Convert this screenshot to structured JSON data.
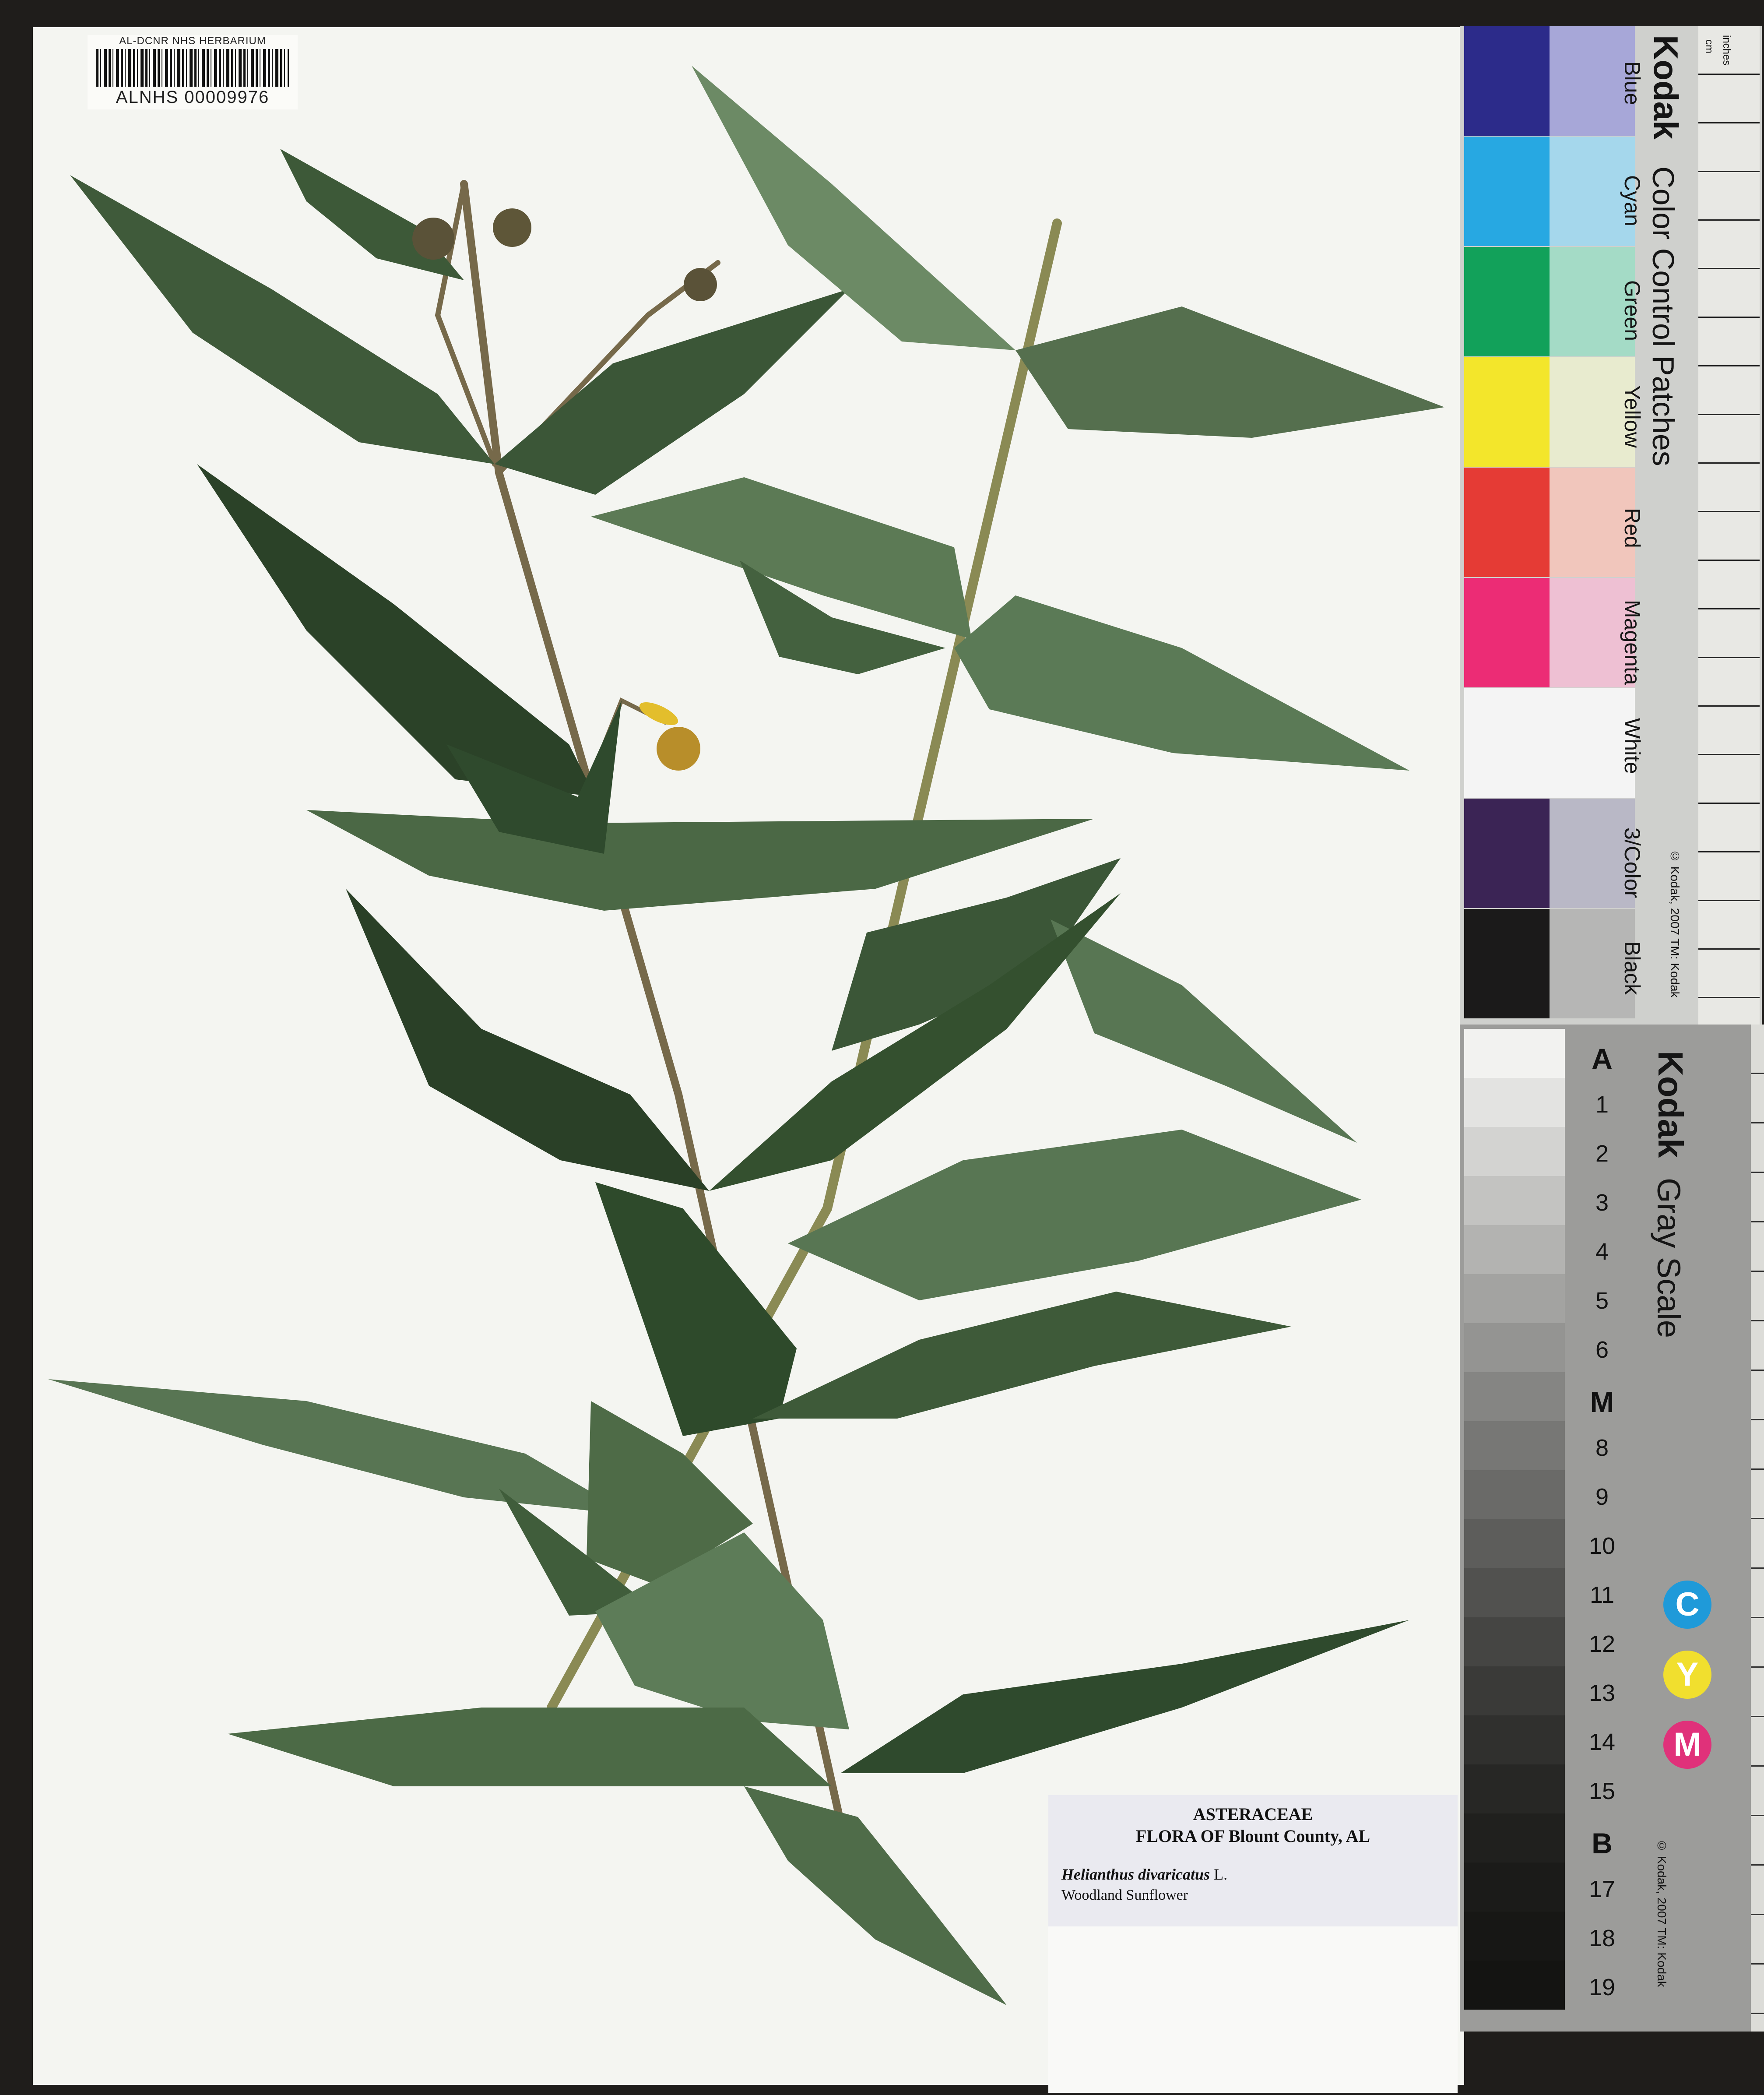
{
  "barcode": {
    "header": "AL-DCNR NHS HERBARIUM",
    "number": "ALNHS 00009976"
  },
  "color_card": {
    "brand": "Kodak",
    "title": "Color Control Patches",
    "patch_names": [
      "Blue",
      "Cyan",
      "Green",
      "Yellow",
      "Red",
      "Magenta",
      "White",
      "3/Color",
      "Black"
    ],
    "patch_colors": [
      [
        "#2c2b8a",
        "#a7a7d8"
      ],
      [
        "#27a8e2",
        "#a5d7ec"
      ],
      [
        "#12a15a",
        "#a4dbc6"
      ],
      [
        "#f3e62b",
        "#e8ebcf"
      ],
      [
        "#e53b35",
        "#f1c6bc"
      ],
      [
        "#ec2c75",
        "#eec0d3"
      ],
      [
        "#f4f4f4",
        "#f4f4f4"
      ],
      [
        "#3b2455",
        "#b9b8c6"
      ],
      [
        "#1b1a1a",
        "#b6b6b5"
      ]
    ],
    "copyright": "© Kodak, 2007 TM: Kodak",
    "ruler_units": [
      "inches",
      "cm"
    ]
  },
  "gray_card": {
    "brand": "Kodak",
    "title": "Gray Scale",
    "steps": [
      "A",
      "1",
      "2",
      "3",
      "4",
      "5",
      "6",
      "M",
      "8",
      "9",
      "10",
      "11",
      "12",
      "13",
      "14",
      "15",
      "B",
      "17",
      "18",
      "19"
    ],
    "cym": [
      "C",
      "Y",
      "M"
    ],
    "cym_colors": [
      "#1f9ad9",
      "#f1df2e",
      "#e0317a"
    ],
    "copyright": "© Kodak, 2007 TM: Kodak"
  },
  "specimen_label": {
    "family": "ASTERACEAE",
    "flora": "FLORA OF Blount County, AL",
    "species": "Helianthus divaricatus",
    "author": "L.",
    "common_name": "Woodland Sunflower"
  }
}
